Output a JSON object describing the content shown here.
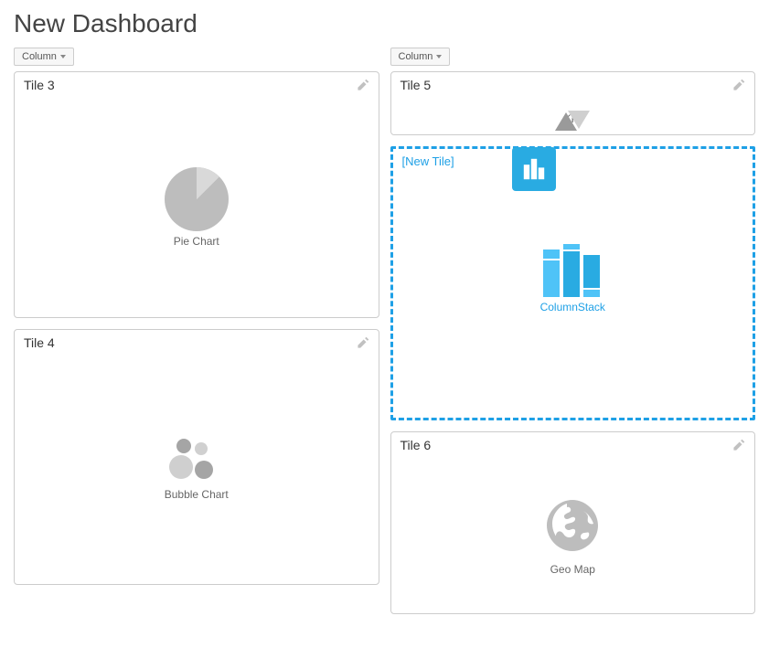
{
  "page_title": "New Dashboard",
  "columns": {
    "left": {
      "button_label": "Column",
      "tiles": [
        {
          "title": "Tile 3",
          "chart_label": "Pie Chart"
        },
        {
          "title": "Tile 4",
          "chart_label": "Bubble Chart"
        }
      ]
    },
    "right": {
      "button_label": "Column",
      "tiles": [
        {
          "title": "Tile 5",
          "chart_label": "KPI"
        },
        {
          "title": "[New Tile]",
          "chart_label": "ColumnStack",
          "selected": true
        },
        {
          "title": "Tile 6",
          "chart_label": "Geo Map"
        }
      ]
    }
  }
}
